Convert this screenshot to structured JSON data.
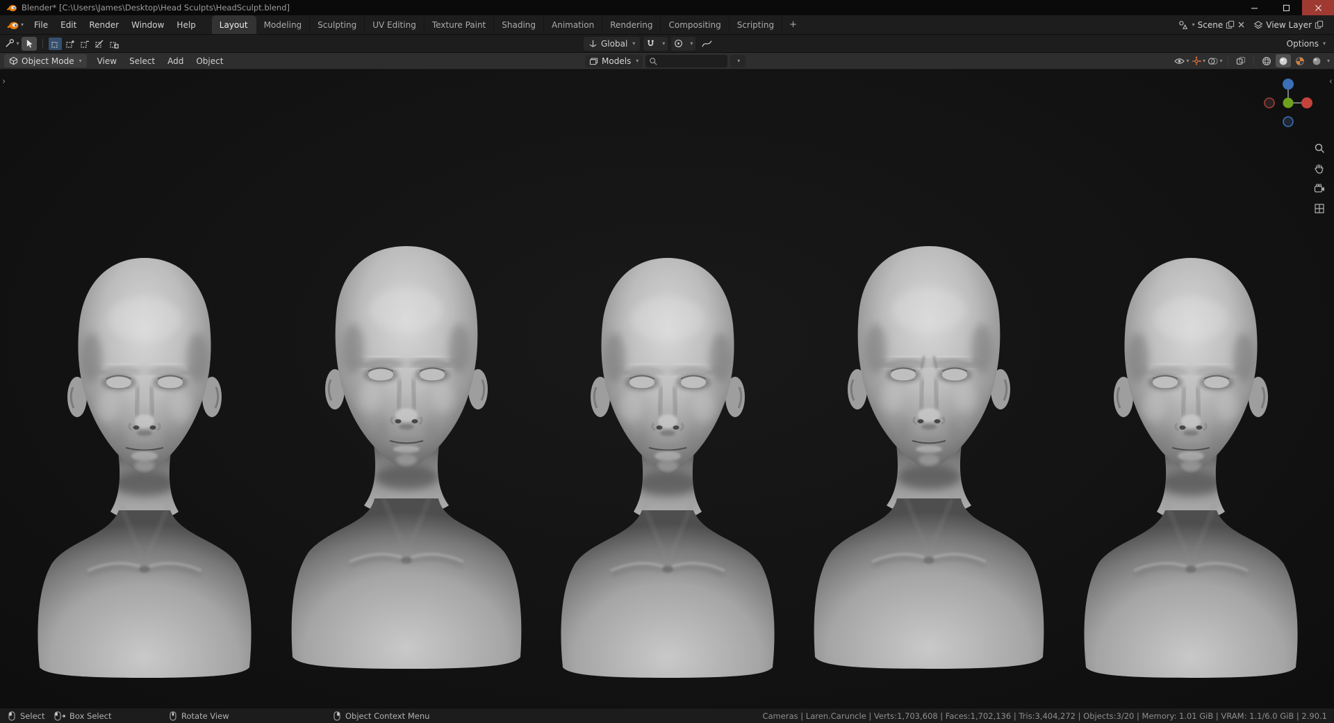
{
  "window": {
    "title": "Blender* [C:\\Users\\James\\Desktop\\Head Sculpts\\HeadSculpt.blend]"
  },
  "topbar": {
    "app_menus": [
      "File",
      "Edit",
      "Render",
      "Window",
      "Help"
    ],
    "workspaces": [
      "Layout",
      "Modeling",
      "Sculpting",
      "UV Editing",
      "Texture Paint",
      "Shading",
      "Animation",
      "Rendering",
      "Compositing",
      "Scripting"
    ],
    "active_workspace": "Layout",
    "new_workspace_label": "+",
    "scene_name": "Scene",
    "view_layer_name": "View Layer"
  },
  "tool_settings": {
    "transform_orientation": "Global",
    "options_label": "Options",
    "select_modes": [
      "Set",
      "Extend",
      "Subtract",
      "Invert",
      "Intersect"
    ],
    "active_select_mode": "Set"
  },
  "viewport": {
    "header": {
      "mode": "Object Mode",
      "menus": [
        "View",
        "Select",
        "Add",
        "Object"
      ],
      "collection": "Models",
      "search_value": "",
      "shading_modes": [
        "Wireframe",
        "Solid",
        "Material Preview",
        "Rendered"
      ],
      "active_shading": "Solid"
    },
    "objects": [
      {
        "build": "female"
      },
      {
        "build": "male"
      },
      {
        "build": "female"
      },
      {
        "build": "male"
      },
      {
        "build": "female"
      }
    ]
  },
  "status_bar": {
    "hints": [
      {
        "icon": "mouse-left",
        "label": "Select"
      },
      {
        "icon": "mouse-left-drag",
        "label": "Box Select"
      },
      {
        "icon": "mouse-middle",
        "label": "Rotate View"
      },
      {
        "icon": "mouse-right",
        "label": "Object Context Menu"
      }
    ],
    "stats": [
      "Cameras",
      "Laren.Caruncle",
      "Verts:1,703,608",
      "Faces:1,702,136",
      "Tris:3,404,272",
      "Objects:3/20",
      "Memory: 1.01 GiB",
      "VRAM: 1.1/6.0 GiB",
      "2.90.1"
    ]
  },
  "colors": {
    "accent": "#4772b3",
    "blender_orange": "#e87d0d",
    "axis_x": "#c4433c",
    "axis_y": "#6fa21c",
    "axis_z": "#3b6fb8"
  },
  "icons": [
    "blender-logo",
    "minimize",
    "maximize",
    "close",
    "scene",
    "new-scene",
    "unlink-scene",
    "view-layer",
    "new-view-layer",
    "editor-type",
    "select-box-tool",
    "transform-orientation",
    "snap-magnet",
    "proportional-editing",
    "falloff-curve",
    "object-mode",
    "collection",
    "search",
    "visibility",
    "gizmo",
    "overlays",
    "xray",
    "shading-wireframe",
    "shading-solid",
    "shading-material",
    "shading-rendered",
    "nav-gizmo",
    "zoom",
    "pan-hand",
    "camera-view",
    "grid-ortho",
    "mouse-left",
    "mouse-left-drag",
    "mouse-middle",
    "mouse-right"
  ]
}
